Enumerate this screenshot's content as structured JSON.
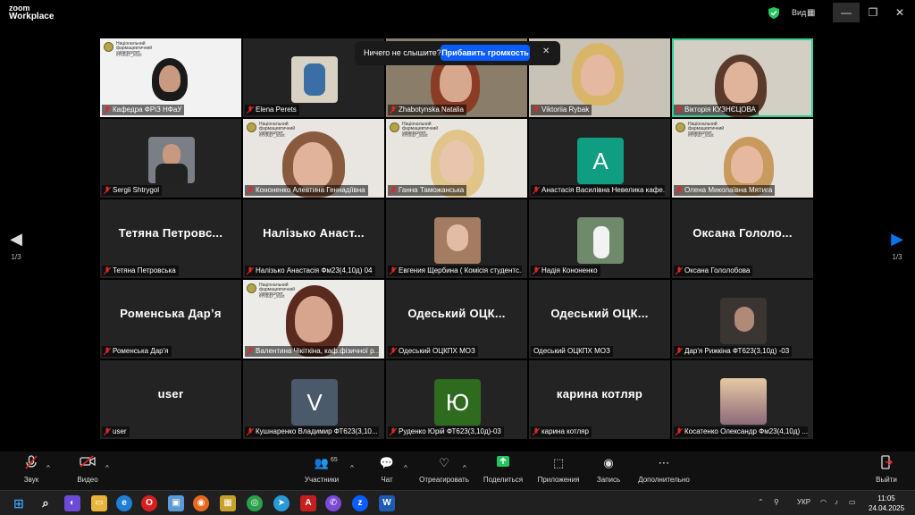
{
  "app": {
    "logo_line1": "zoom",
    "logo_line2": "Workplace",
    "view_label": "Вид",
    "view_icon": "grid-icon"
  },
  "banner": {
    "text": "Ничего не слышите?",
    "button": "Прибавить громкость",
    "close": "✕"
  },
  "university": {
    "line1": "Національний фармацевтичний",
    "line2": "університет",
    "hashtag": "#НФаУ_start"
  },
  "pagination": {
    "left": "1/3",
    "right": "1/3"
  },
  "tiles": [
    {
      "label": "Кафедра ФРіЗ НФаУ",
      "big": ""
    },
    {
      "label": "Elena Perets",
      "big": ""
    },
    {
      "label": "Zhabotynska Natalia",
      "big": ""
    },
    {
      "label": "Viktoriia Rybak",
      "big": ""
    },
    {
      "label": "Вікторія КУЗНЄЦОВА",
      "big": ""
    },
    {
      "label": "Sergii Shtrygol",
      "big": ""
    },
    {
      "label": "Кононенко Алевтина Геннадіївна",
      "big": ""
    },
    {
      "label": "Ганна Таможанська",
      "big": ""
    },
    {
      "label": "Анастасія Василівна Невелика кафе...",
      "big": "",
      "avatar": "A"
    },
    {
      "label": "Олена Миколаївна Мятига",
      "big": ""
    },
    {
      "label": "Тетяна Петровська",
      "big": "Тетяна Петровс..."
    },
    {
      "label": "Налізько Анастасія Фм23(4,10д) 04",
      "big": "Налізько Анаст..."
    },
    {
      "label": "Евгения Щербина ( Комісія студентс...",
      "big": ""
    },
    {
      "label": "Надія Кононенко",
      "big": ""
    },
    {
      "label": "Оксана Гололобова",
      "big": "Оксана Гололо..."
    },
    {
      "label": "Роменська Дар'я",
      "big": "Роменська Дарʼя"
    },
    {
      "label": "Валентина Чікіткіна, каф.фізичної р...",
      "big": ""
    },
    {
      "label": "Одеський ОЦКПХ МОЗ",
      "big": "Одеський ОЦК..."
    },
    {
      "label": "Одеський ОЦКПХ МОЗ",
      "big": "Одеський ОЦК..."
    },
    {
      "label": "Дар'я Рижкіна ФТ623(3,10д) -03",
      "big": ""
    },
    {
      "label": "user",
      "big": "user"
    },
    {
      "label": "Кушнаренко Владимир ФТ623(3,10...",
      "big": "",
      "avatar": "V"
    },
    {
      "label": "Руденко Юрій ФТ623(3,10д)-03",
      "big": "",
      "avatar": "Ю"
    },
    {
      "label": "карина котляр",
      "big": "карина котляр"
    },
    {
      "label": "Косатенко Олександр Фм23(4,10д) ...",
      "big": ""
    }
  ],
  "toolbar": {
    "audio": "Звук",
    "video": "Видео",
    "participants": "Участники",
    "participants_count": "65",
    "chat": "Чат",
    "react": "Отреагировать",
    "share": "Поделиться",
    "apps": "Приложения",
    "record": "Запись",
    "more": "Дополнительно",
    "leave": "Выйти"
  },
  "taskbar": {
    "lang": "УКР",
    "time": "11:05",
    "date": "24.04.2025"
  },
  "colors": {
    "accent": "#0b5cff",
    "active_speaker": "#2dd29a",
    "muted_red": "#e02828",
    "share_green": "#22c55e"
  }
}
